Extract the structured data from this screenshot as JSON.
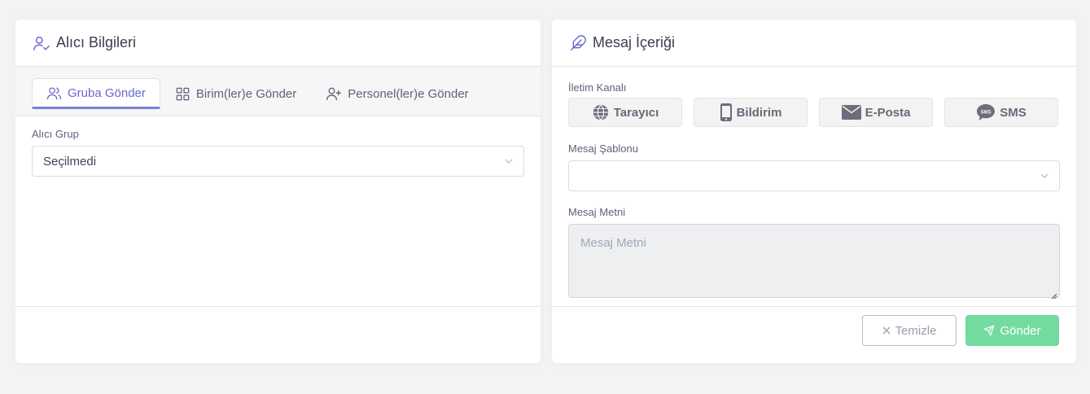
{
  "recipient_card": {
    "title": "Alıcı Bilgileri",
    "title_icon": "user-check-icon",
    "tabs": [
      {
        "label": "Gruba Gönder",
        "icon": "users-icon",
        "active": true
      },
      {
        "label": "Birim(ler)e Gönder",
        "icon": "grid-icon",
        "active": false
      },
      {
        "label": "Personel(ler)e Gönder",
        "icon": "user-plus-icon",
        "active": false
      }
    ],
    "group_label": "Alıcı Grup",
    "group_value": "Seçilmedi"
  },
  "message_card": {
    "title": "Mesaj İçeriği",
    "title_icon": "feather-icon",
    "channel_label": "İletim Kanalı",
    "channels": [
      {
        "label": "Tarayıcı",
        "icon": "globe-icon"
      },
      {
        "label": "Bildirim",
        "icon": "mobile-icon"
      },
      {
        "label": "E-Posta",
        "icon": "envelope-icon"
      },
      {
        "label": "SMS",
        "icon": "sms-icon"
      }
    ],
    "template_label": "Mesaj Şablonu",
    "template_value": "",
    "text_label": "Mesaj Metni",
    "text_placeholder": "Mesaj Metni",
    "clear_button": "Temizle",
    "send_button": "Gönder"
  },
  "colors": {
    "accent": "#6a67ce",
    "send": "#74dba0",
    "page_bg": "#f3f3f4"
  }
}
